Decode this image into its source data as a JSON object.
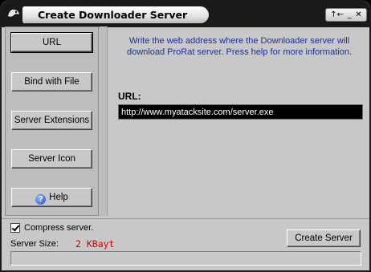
{
  "window": {
    "title": "Create Downloader Server",
    "controls": {
      "back": "↑←",
      "minimize": "_",
      "close": "✕"
    }
  },
  "sidebar": {
    "items": [
      {
        "label": "URL",
        "active": true
      },
      {
        "label": "Bind with File",
        "active": false
      },
      {
        "label": "Server Extensions",
        "active": false
      },
      {
        "label": "Server Icon",
        "active": false
      },
      {
        "label": "Help",
        "icon": "help-icon",
        "active": false
      }
    ]
  },
  "main": {
    "info_text": "Write the web address where the Downloader server will download ProRat server. Press help for more information.",
    "url_label": "URL:",
    "url_value": "http://www.myatacksite.com/server.exe"
  },
  "footer": {
    "compress_label": "Compress server.",
    "compress_checked": true,
    "size_label": "Server Size:",
    "size_value": "2 KBayt",
    "create_button": "Create Server",
    "progress": 0
  },
  "colors": {
    "info_text": "#1c2f9a",
    "size_value": "#d40000",
    "url_field_bg": "#000000",
    "window_bg": "#c8c8c8"
  }
}
